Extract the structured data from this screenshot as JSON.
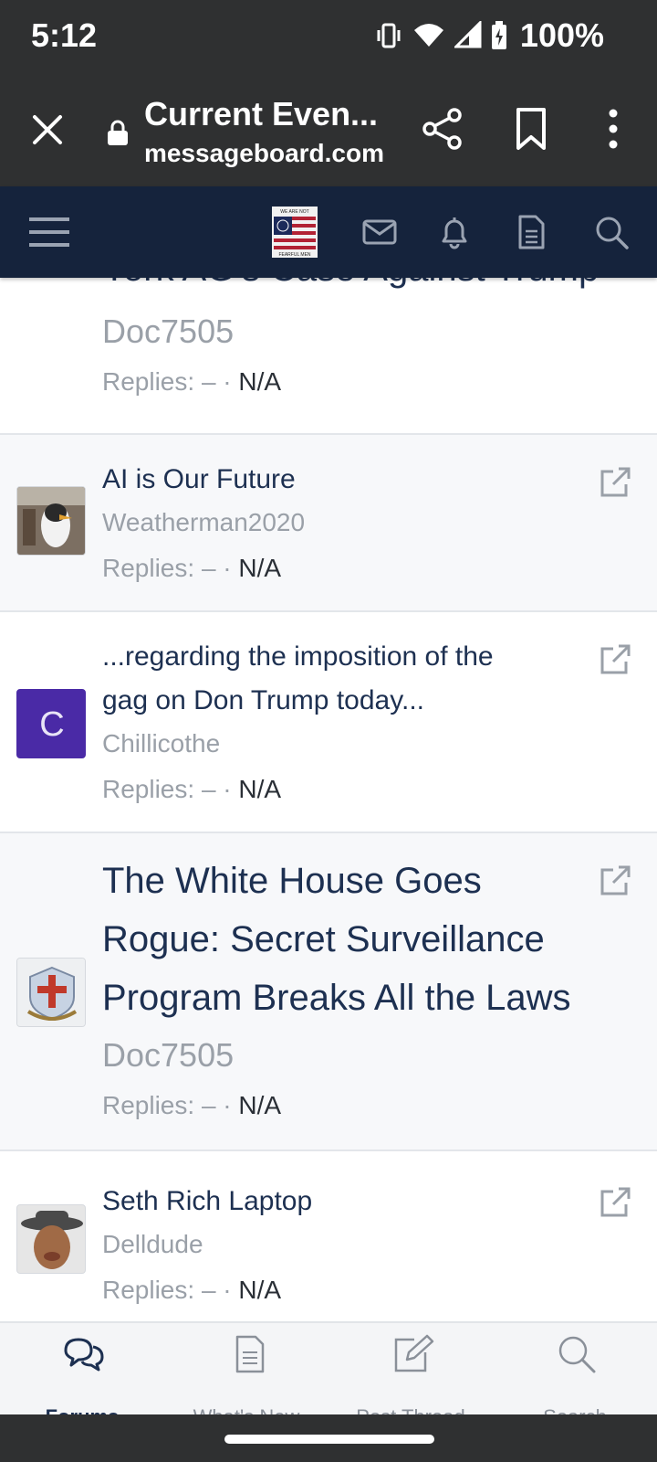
{
  "status": {
    "time": "5:12",
    "battery": "100%"
  },
  "browser": {
    "title": "Current Even...",
    "url": "messageboard.com"
  },
  "forum": {
    "logo_text_top": "WE ARE NOT",
    "logo_text_bottom": "FEARFUL MEN"
  },
  "threads": [
    {
      "title": "York AG's Case Against Trump",
      "author": "Doc7505",
      "replies_label": "Replies:",
      "replies_sep": "– ·",
      "replies_value": "N/A"
    },
    {
      "title": "AI is Our Future",
      "author": "Weatherman2020",
      "replies_label": "Replies:",
      "replies_sep": "– ·",
      "replies_value": "N/A"
    },
    {
      "title_line1": "...regarding the imposition of the",
      "title_line2": "gag on Don Trump today...",
      "author": "Chillicothe",
      "avatar_letter": "C",
      "replies_label": "Replies:",
      "replies_sep": "– ·",
      "replies_value": "N/A"
    },
    {
      "title_line1": "The White House Goes",
      "title_line2": "Rogue: Secret Surveillance",
      "title_line3": "Program Breaks All the Laws",
      "author": "Doc7505",
      "replies_label": "Replies:",
      "replies_sep": "– ·",
      "replies_value": "N/A"
    },
    {
      "title": "Seth Rich Laptop",
      "author": "Delldude",
      "replies_label": "Replies:",
      "replies_sep": "– ·",
      "replies_value": "N/A"
    }
  ],
  "tabs": [
    {
      "label": "Forums",
      "icon": "forums-icon",
      "active": true
    },
    {
      "label": "What's New",
      "icon": "document-icon"
    },
    {
      "label": "Post Thread",
      "icon": "edit-icon"
    },
    {
      "label": "Search",
      "icon": "search-icon"
    }
  ],
  "colors": {
    "system_bar": "#2f3031",
    "forum_nav": "#15233c",
    "title_text": "#1d3051",
    "muted_text": "#9aa0a8",
    "avatar_purple": "#4a2aa6"
  }
}
